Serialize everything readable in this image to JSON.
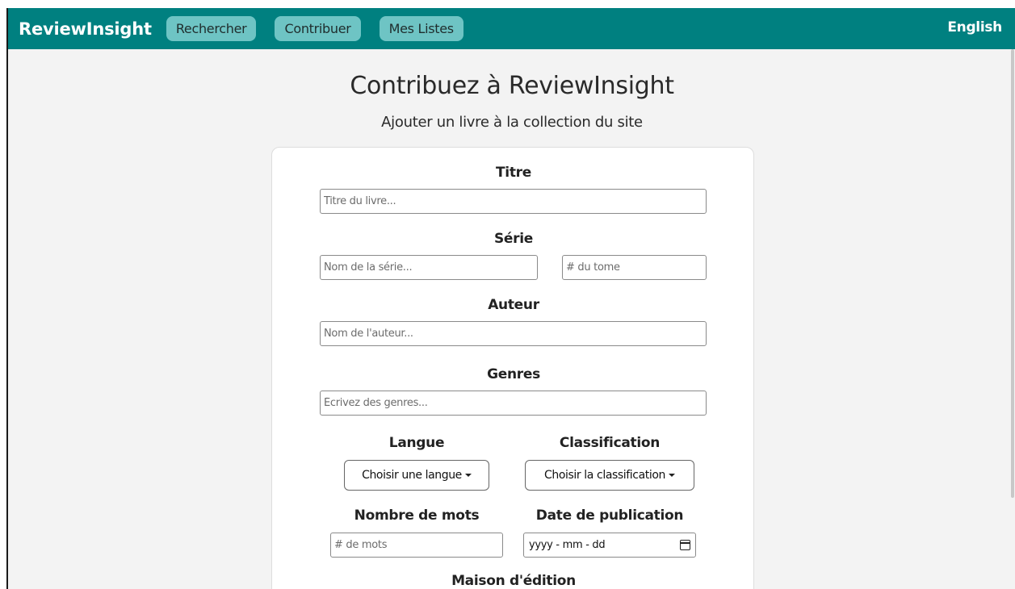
{
  "navbar": {
    "brand": "ReviewInsight",
    "items": [
      {
        "label": "Rechercher"
      },
      {
        "label": "Contribuer"
      },
      {
        "label": "Mes Listes"
      }
    ],
    "language_toggle": "English"
  },
  "page": {
    "title": "Contribuez à ReviewInsight",
    "subtitle": "Ajouter un livre à la collection du site"
  },
  "form": {
    "title": {
      "label": "Titre",
      "placeholder": "Titre du livre..."
    },
    "series": {
      "label": "Série",
      "name_placeholder": "Nom de la série...",
      "volume_placeholder": "# du tome"
    },
    "author": {
      "label": "Auteur",
      "placeholder": "Nom de l'auteur..."
    },
    "genres": {
      "label": "Genres",
      "placeholder": "Écrivez des genres..."
    },
    "language": {
      "label": "Langue",
      "dropdown": "Choisir une langue"
    },
    "classification": {
      "label": "Classification",
      "dropdown": "Choisir la classification"
    },
    "word_count": {
      "label": "Nombre de mots",
      "placeholder": "# de mots"
    },
    "publication_date": {
      "label": "Date de publication",
      "value": "yyyy - mm - dd"
    },
    "publisher": {
      "label": "Maison d'édition"
    }
  },
  "colors": {
    "navbar": "#008080",
    "nav_button": "#6ec4c4",
    "background": "#f3f3f3"
  }
}
